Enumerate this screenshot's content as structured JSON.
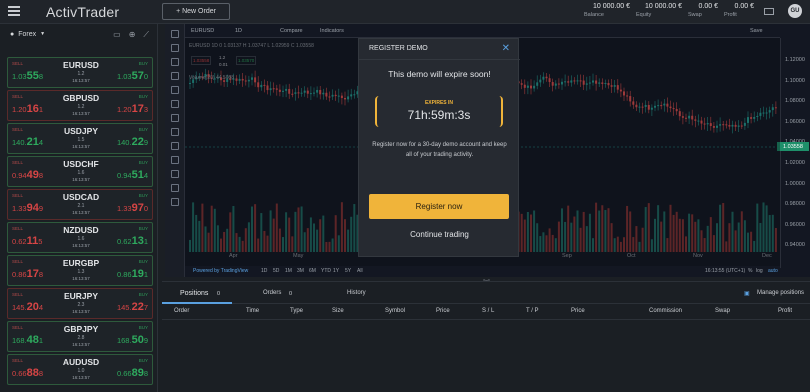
{
  "header": {
    "logo": "ActivTrader",
    "new_order": "+ New Order",
    "account": [
      {
        "value": "10 000.00 €",
        "label": "Balance"
      },
      {
        "value": "10 000.00 €",
        "label": "Equity"
      },
      {
        "value": "0.00 €",
        "label": "Swap"
      },
      {
        "value": "0.00 €",
        "label": "Profit"
      }
    ],
    "avatar": "GU"
  },
  "sidebar": {
    "category": "Forex",
    "instruments": [
      {
        "symbol": "EURUSD",
        "sell_pre": "1.03",
        "sell_big": "55",
        "sell_sup": "8",
        "buy_pre": "1.03",
        "buy_big": "57",
        "buy_sup": "0",
        "spread": "1.2",
        "time": "16:13:57",
        "dir": "green"
      },
      {
        "symbol": "GBPUSD",
        "sell_pre": "1.20",
        "sell_big": "16",
        "sell_sup": "1",
        "buy_pre": "1.20",
        "buy_big": "17",
        "buy_sup": "3",
        "spread": "1.2",
        "time": "16:13:57",
        "dir": "red"
      },
      {
        "symbol": "USDJPY",
        "sell_pre": "140.",
        "sell_big": "21",
        "sell_sup": "4",
        "buy_pre": "140.",
        "buy_big": "22",
        "buy_sup": "9",
        "spread": "1.5",
        "time": "16:13:57",
        "dir": "green"
      },
      {
        "symbol": "USDCHF",
        "sell_pre": "0.94",
        "sell_big": "49",
        "sell_sup": "8",
        "buy_pre": "0.94",
        "buy_big": "51",
        "buy_sup": "4",
        "spread": "1.6",
        "time": "16:13:57",
        "dir": "mixed"
      },
      {
        "symbol": "USDCAD",
        "sell_pre": "1.33",
        "sell_big": "94",
        "sell_sup": "9",
        "buy_pre": "1.33",
        "buy_big": "97",
        "buy_sup": "0",
        "spread": "2.1",
        "time": "16:13:57",
        "dir": "red"
      },
      {
        "symbol": "NZDUSD",
        "sell_pre": "0.62",
        "sell_big": "11",
        "sell_sup": "5",
        "buy_pre": "0.62",
        "buy_big": "13",
        "buy_sup": "1",
        "spread": "1.6",
        "time": "16:13:57",
        "dir": "mixed"
      },
      {
        "symbol": "EURGBP",
        "sell_pre": "0.86",
        "sell_big": "17",
        "sell_sup": "8",
        "buy_pre": "0.86",
        "buy_big": "19",
        "buy_sup": "1",
        "spread": "1.3",
        "time": "16:13:57",
        "dir": "mixed"
      },
      {
        "symbol": "EURJPY",
        "sell_pre": "145.",
        "sell_big": "20",
        "sell_sup": "4",
        "buy_pre": "145.",
        "buy_big": "22",
        "buy_sup": "7",
        "spread": "2.3",
        "time": "16:13:57",
        "dir": "mixed2"
      },
      {
        "symbol": "GBPJPY",
        "sell_pre": "168.",
        "sell_big": "48",
        "sell_sup": "1",
        "buy_pre": "168.",
        "buy_big": "50",
        "buy_sup": "9",
        "spread": "2.8",
        "time": "16:13:57",
        "dir": "green"
      },
      {
        "symbol": "AUDUSD",
        "sell_pre": "0.66",
        "sell_big": "88",
        "sell_sup": "8",
        "buy_pre": "0.66",
        "buy_big": "89",
        "buy_sup": "8",
        "spread": "1.0",
        "time": "16:13:57",
        "dir": "mixed"
      }
    ],
    "sell_label": "SELL",
    "buy_label": "BUY"
  },
  "chart": {
    "symbol": "EURUSD",
    "timeframe": "1D",
    "compare": "Compare",
    "indicators": "Indicators",
    "save": "Save",
    "ohlc": "EURUSD 1D 0 1.03137 H 1.03747 L 1.02959 C 1.03558",
    "volume": "Volume(20) 44.5088",
    "bid_box": "1.03558",
    "spread_box": "1.2",
    "spread_box2": "0.01",
    "ask_box": "1.03570",
    "current_price": "1.03558",
    "y_ticks": [
      "1.12000",
      "1.10000",
      "1.08000",
      "1.06000",
      "1.04000",
      "1.02000",
      "1.00000",
      "0.98000",
      "0.96000",
      "0.94000"
    ],
    "x_ticks": [
      "Apr",
      "May",
      "Sep",
      "Oct",
      "Nov",
      "Dec"
    ],
    "timeframes": [
      "1D",
      "5D",
      "1M",
      "3M",
      "6M",
      "YTD",
      "1Y",
      "5Y",
      "All"
    ],
    "powered": "Powered by TradingView",
    "clock": "16:13:55 (UTC+1)",
    "pct": "%",
    "log": "log",
    "auto": "auto"
  },
  "modal": {
    "title": "REGISTER DEMO",
    "warning": "This demo will expire soon!",
    "timer_label": "EXPIRES IN",
    "timer_value": "71h:59m:3s",
    "description": "Register now for a 30-day demo account and keep all of your trading activity.",
    "register": "Register now",
    "continue": "Continue trading"
  },
  "bottom": {
    "tabs": [
      {
        "label": "Positions",
        "count": "0"
      },
      {
        "label": "Orders",
        "count": "0"
      },
      {
        "label": "History",
        "count": ""
      }
    ],
    "manage": "Manage positions",
    "columns": [
      "Order",
      "Time",
      "Type",
      "Size",
      "Symbol",
      "Price",
      "S / L",
      "T / P",
      "Price",
      "Commission",
      "Swap",
      "Profit"
    ]
  },
  "colors": {
    "buy": "#2eaa5e",
    "sell": "#d64545",
    "accent": "#f0b43a",
    "link": "#5aa0e0"
  },
  "icons": [
    "menu-icon",
    "mail-icon",
    "settings-icon",
    "zoom-icon",
    "draw-icon",
    "close-icon"
  ]
}
